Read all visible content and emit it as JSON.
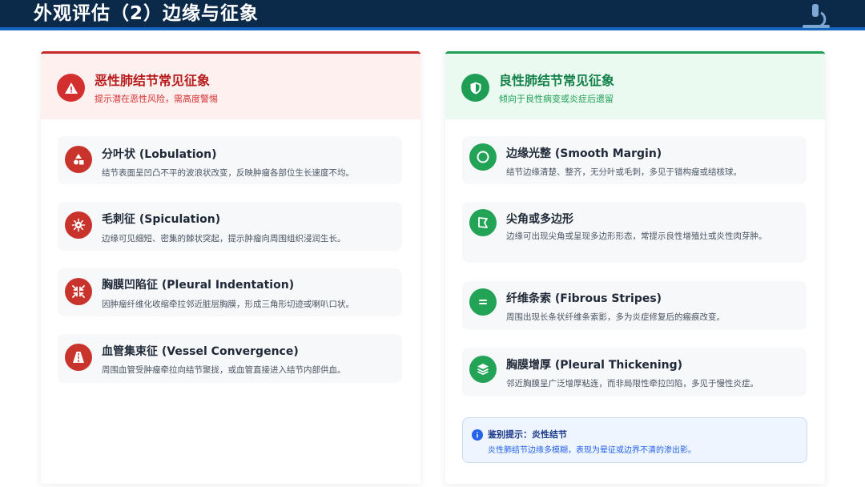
{
  "header": {
    "title": "外观评估（2）边缘与征象",
    "logo_icon": "microscope-icon"
  },
  "malignant": {
    "title": "恶性肺结节常见征象",
    "subtitle": "提示潜在恶性风险，需高度警惕",
    "icon": "warning-triangle-icon",
    "accent": "#c62828",
    "items": [
      {
        "title": "分叶状 (Lobulation)",
        "desc": "结节表面呈凹凸不平的波浪状改变，反映肿瘤各部位生长速度不均。",
        "icon": "shapes-icon"
      },
      {
        "title": "毛刺征 (Spiculation)",
        "desc": "边缘可见细短、密集的棘状突起，提示肿瘤向周围组织浸润生长。",
        "icon": "virus-icon"
      },
      {
        "title": "胸膜凹陷征 (Pleural Indentation)",
        "desc": "因肿瘤纤维化收缩牵拉邻近脏层胸膜，形成三角形切迹或喇叭口状。",
        "icon": "compress-arrows-icon"
      },
      {
        "title": "血管集束征 (Vessel Convergence)",
        "desc": "周围血管受肿瘤牵拉向结节聚拢，或血管直接进入结节内部供血。",
        "icon": "road-convergence-icon"
      }
    ]
  },
  "benign": {
    "title": "良性肺结节常见征象",
    "subtitle": "倾向于良性病变或炎症后遗留",
    "icon": "shield-icon",
    "accent": "#1e9e55",
    "items": [
      {
        "title": "边缘光整 (Smooth Margin)",
        "desc": "结节边缘清楚、整齐，无分叶或毛刺，多见于错构瘤或结核球。",
        "icon": "circle-outline-icon"
      },
      {
        "title": "尖角或多边形",
        "desc": "边缘可出现尖角或呈现多边形形态，常提示良性增殖灶或炎性肉芽肿。",
        "icon": "polygon-icon"
      },
      {
        "title": "纤维条索 (Fibrous Stripes)",
        "desc": "周围出现长条状纤维条索影，多为炎症修复后的瘢痕改变。",
        "icon": "equals-lines-icon"
      },
      {
        "title": "胸膜增厚 (Pleural Thickening)",
        "desc": "邻近胸膜呈广泛增厚粘连，而非局限性牵拉凹陷，多见于慢性炎症。",
        "icon": "layers-icon"
      }
    ],
    "note": {
      "title": "鉴别提示：炎性结节",
      "text": "炎性肺结节边缘多模糊，表现为晕征或边界不清的渗出影。",
      "icon": "info-icon"
    }
  }
}
